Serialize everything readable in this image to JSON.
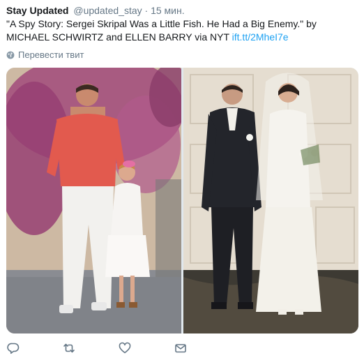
{
  "tweet": {
    "author_name": "Stay Updated",
    "author_handle": "@updated_stay",
    "separator": "·",
    "time": "15 мин.",
    "text": "\"A Spy Story: Sergei Skripal Was a Little Fish. He Had a Big Enemy.\" by MICHAEL SCHWIRTZ and ELLEN BARRY via NYT",
    "link": "ift.tt/2MheI7e",
    "translate_label": "Перевести твит"
  },
  "icons": {
    "translate": "globe-icon",
    "reply": "reply-icon",
    "retweet": "retweet-icon",
    "like": "heart-icon",
    "message": "envelope-icon"
  },
  "colors": {
    "link": "#1da1f2",
    "secondary_text": "#657786",
    "primary_text": "#14171a"
  }
}
